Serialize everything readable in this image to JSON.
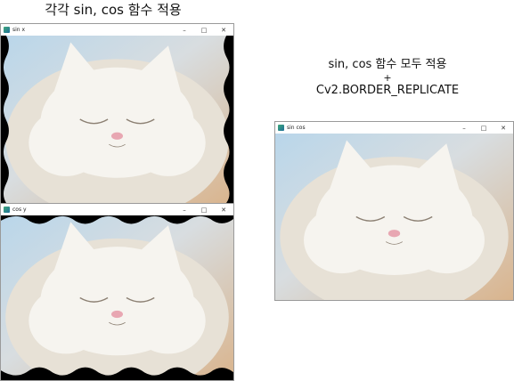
{
  "captions": {
    "left": "각각 sin, cos 함수 적용",
    "right_line1": "sin, cos 함수 모두 적용",
    "right_line2": "+",
    "right_line3": "Cv2.BORDER_REPLICATE"
  },
  "windows": {
    "sin_x": {
      "title": "sin x"
    },
    "cos_y": {
      "title": "cos y"
    },
    "sin_cos": {
      "title": "sin cos"
    }
  },
  "titlebar_buttons": {
    "minimize": "–",
    "maximize": "□",
    "close": "✕"
  },
  "colors": {
    "background_top": "#b9d6ea",
    "background_warm": "#d9b48d",
    "fur": "#f6f4ef",
    "fur_shade": "#e7e1d6",
    "nose": "#e8a7b2",
    "eye_line": "#8c8073",
    "wave_black": "#000000"
  }
}
